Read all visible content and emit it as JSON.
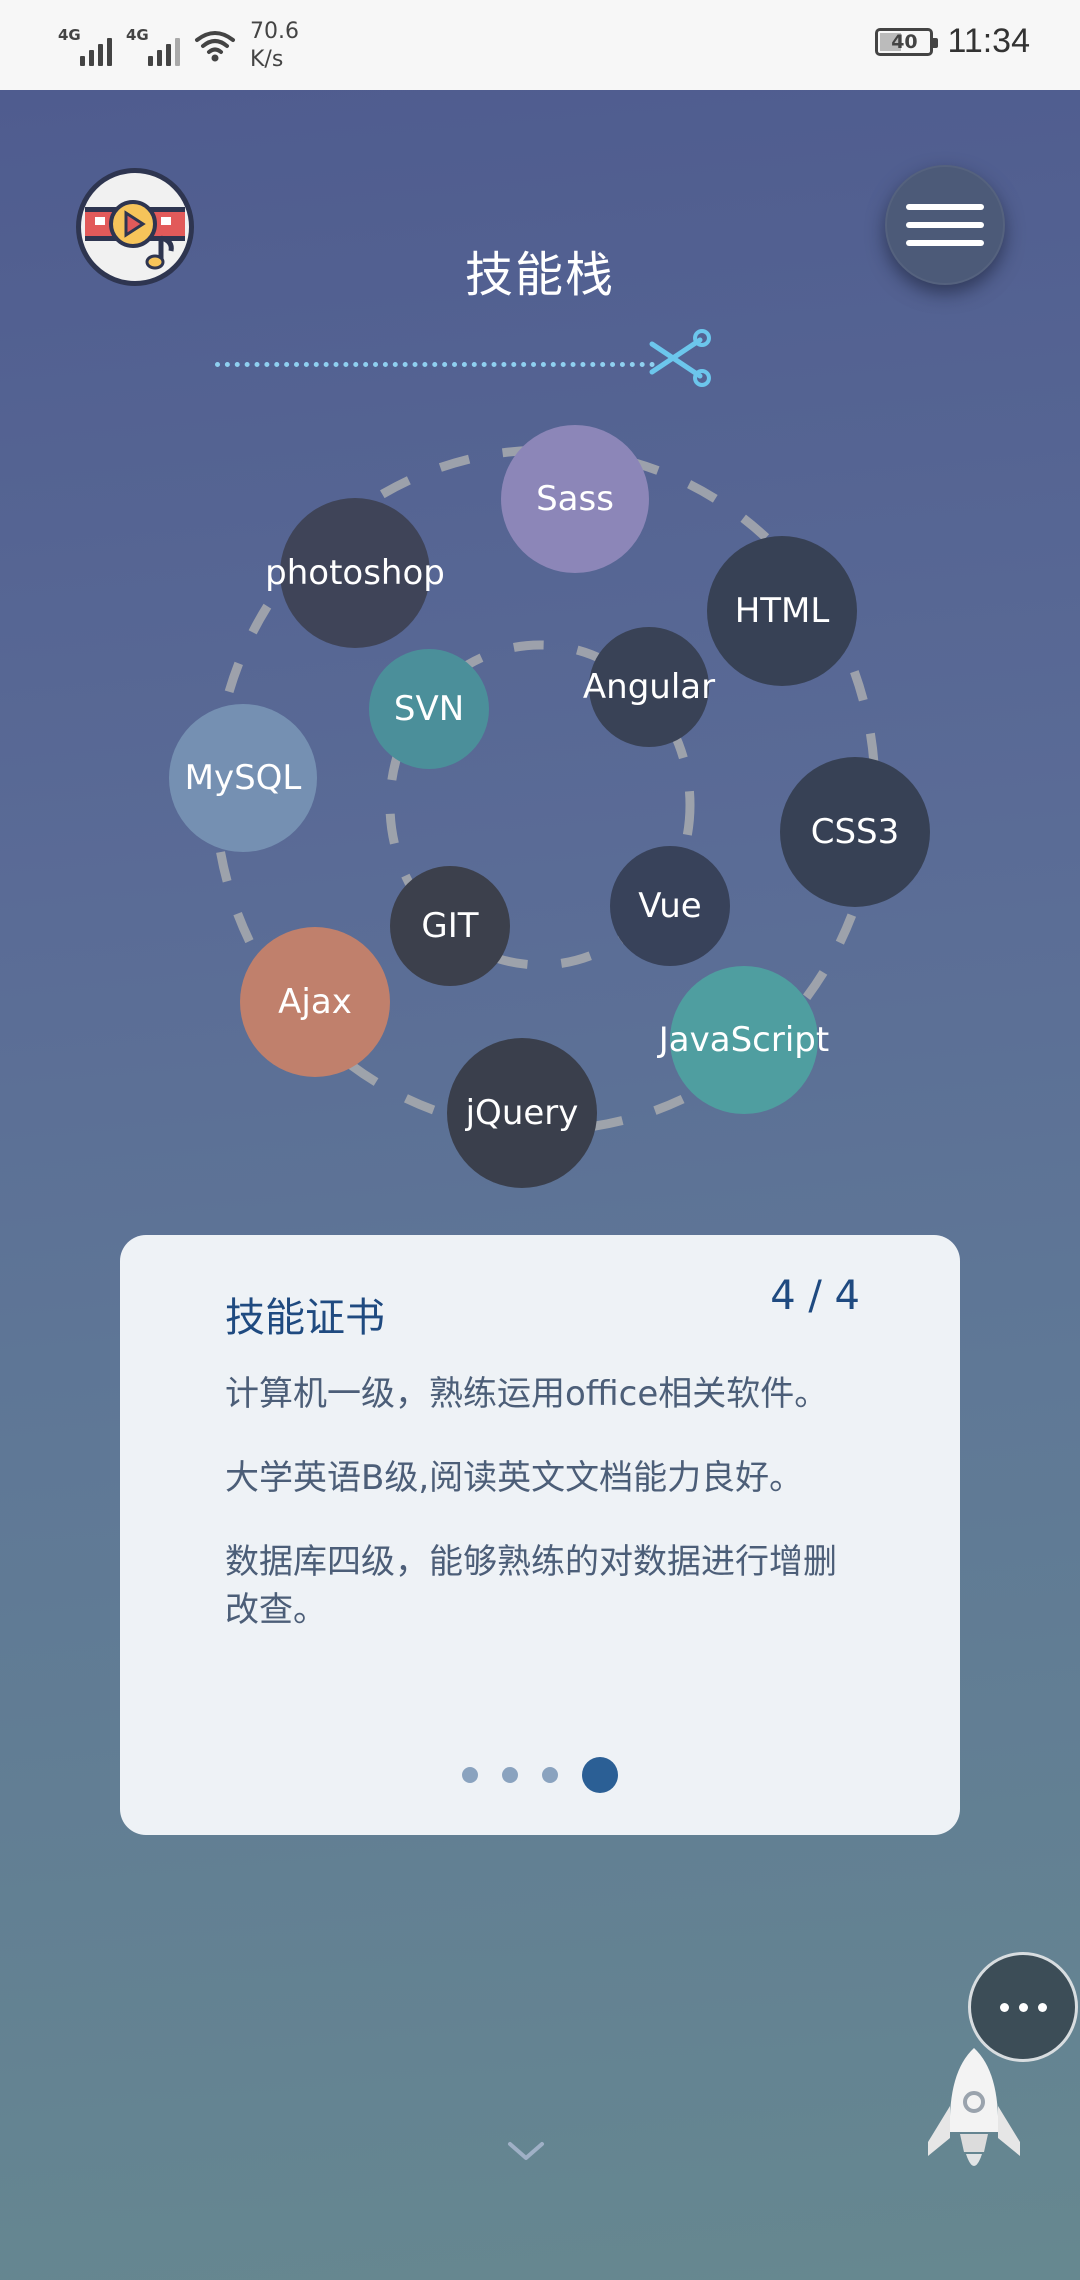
{
  "status_bar": {
    "network_1": "4G",
    "network_2": "4G",
    "speed_value": "70.6",
    "speed_unit": "K/s",
    "battery": "40",
    "time": "11:34"
  },
  "header": {
    "title": "技能栈"
  },
  "skills": [
    {
      "label": "Sass",
      "color": "#8c86b8"
    },
    {
      "label": "HTML",
      "color": "#374155"
    },
    {
      "label": "CSS3",
      "color": "#374155"
    },
    {
      "label": "JavaScript",
      "color": "#4f9ea0"
    },
    {
      "label": "jQuery",
      "color": "#3a3f4c"
    },
    {
      "label": "Ajax",
      "color": "#c0806c"
    },
    {
      "label": "MySQL",
      "color": "#7590b2"
    },
    {
      "label": "photoshop",
      "color": "#3f4458"
    },
    {
      "label": "SVN",
      "color": "#4b8f9a"
    },
    {
      "label": "Angular",
      "color": "#394256"
    },
    {
      "label": "Vue",
      "color": "#38425a"
    },
    {
      "label": "GIT",
      "color": "#3c404c"
    }
  ],
  "card": {
    "title": "技能证书",
    "counter": "4 / 4",
    "lines": [
      "计算机一级，熟练运用office相关软件。",
      "大学英语B级,阅读英文文档能力良好。",
      "数据库四级，能够熟练的对数据进行增删改查。"
    ],
    "pager_total": 4,
    "pager_active": 4
  }
}
